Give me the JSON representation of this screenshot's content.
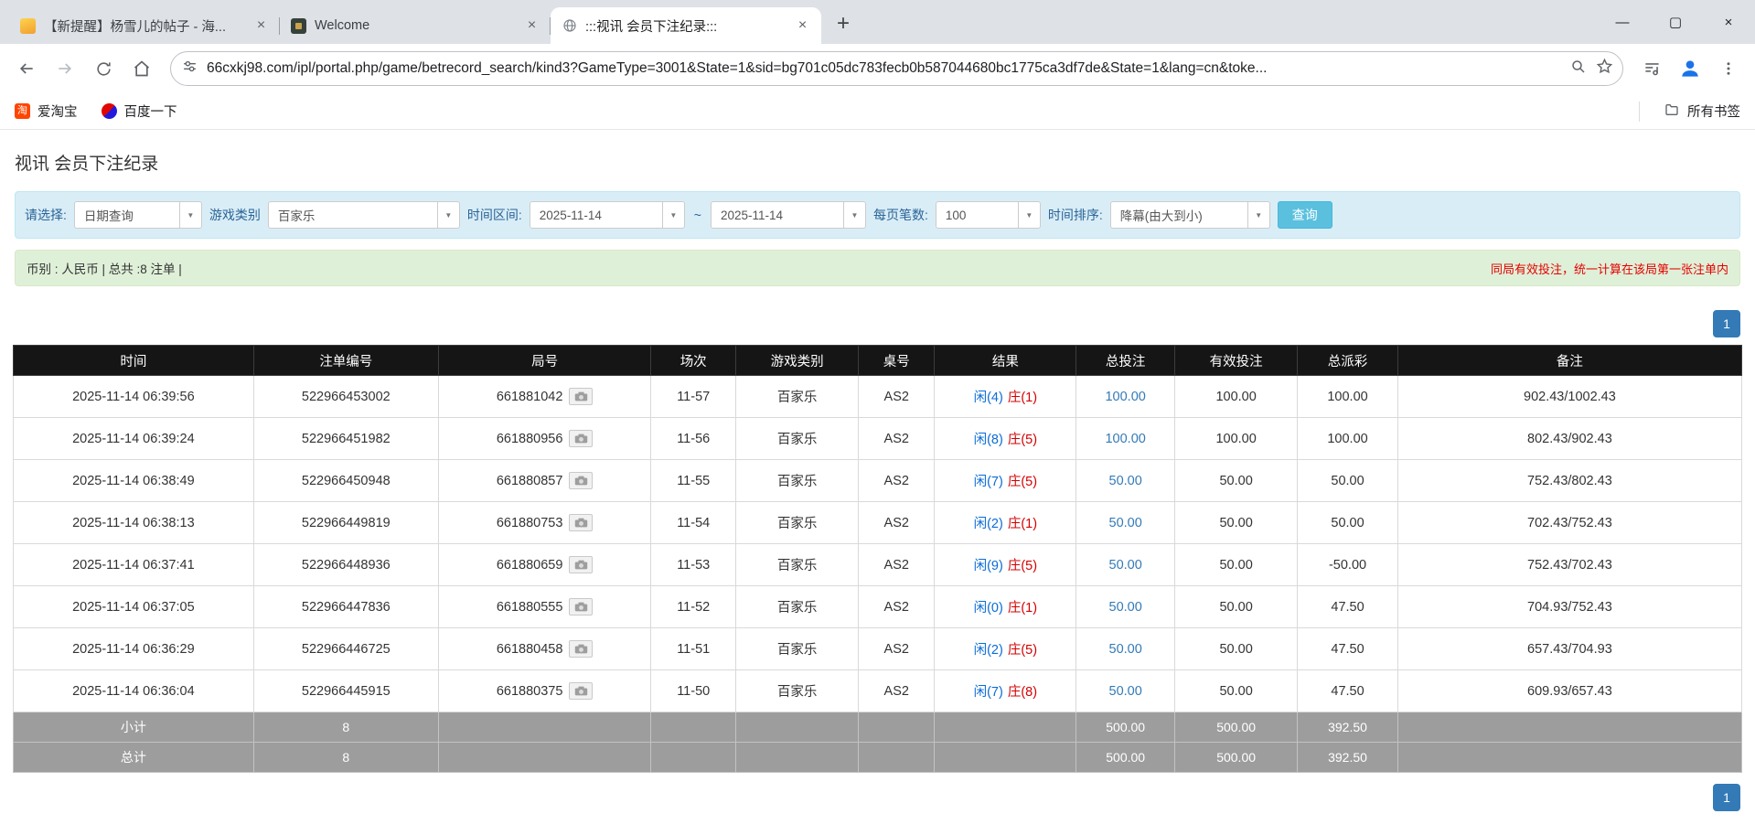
{
  "browser": {
    "tabs": [
      {
        "title": "【新提醒】杨雪儿的帖子 - 海...",
        "active": false
      },
      {
        "title": "Welcome",
        "active": false
      },
      {
        "title": ":::视讯 会员下注纪录:::",
        "active": true
      }
    ],
    "tab_close": "×",
    "new_tab": "+",
    "window_controls": {
      "minimize": "—",
      "maximize": "▢",
      "close": "×"
    },
    "url": "66cxkj98.com/ipl/portal.php/game/betrecord_search/kind3?GameType=3001&State=1&sid=bg701c05dc783fecb0b587044680bc1775ca3df7de&State=1&lang=cn&toke...",
    "bookmarks": {
      "taobao": "爱淘宝",
      "taobao_glyph": "淘",
      "baidu": "百度一下",
      "all_bookmarks": "所有书签"
    }
  },
  "page": {
    "title": "视讯 会员下注纪录",
    "filters": {
      "caret": "▼",
      "select_label": "请选择:",
      "select_value": "日期查询",
      "game_type_label": "游戏类别",
      "game_type_value": "百家乐",
      "time_range_label": "时间区间:",
      "time_from": "2025-11-14",
      "time_separator": "~",
      "time_to": "2025-11-14",
      "per_page_label": "每页笔数:",
      "per_page_value": "100",
      "sort_label": "时间排序:",
      "sort_value": "降幕(由大到小)",
      "search_button": "查询"
    },
    "summary": {
      "left": "币别 : 人民币 | 总共 :8 注单 |",
      "right": "同局有效投注，统一计算在该局第一张注单内"
    },
    "pagination": "1",
    "table": {
      "headers": [
        "时间",
        "注单编号",
        "局号",
        "场次",
        "游戏类别",
        "桌号",
        "结果",
        "总投注",
        "有效投注",
        "总派彩",
        "备注"
      ],
      "rows": [
        {
          "time": "2025-11-14 06:39:56",
          "bet_id": "522966453002",
          "round_id": "661881042",
          "session": "11-57",
          "game": "百家乐",
          "table_no": "AS2",
          "result_player": "闲(4)",
          "result_banker": "庄(1)",
          "total_bet": "100.00",
          "valid_bet": "100.00",
          "payout": "100.00",
          "note": "902.43/1002.43"
        },
        {
          "time": "2025-11-14 06:39:24",
          "bet_id": "522966451982",
          "round_id": "661880956",
          "session": "11-56",
          "game": "百家乐",
          "table_no": "AS2",
          "result_player": "闲(8)",
          "result_banker": "庄(5)",
          "total_bet": "100.00",
          "valid_bet": "100.00",
          "payout": "100.00",
          "note": "802.43/902.43"
        },
        {
          "time": "2025-11-14 06:38:49",
          "bet_id": "522966450948",
          "round_id": "661880857",
          "session": "11-55",
          "game": "百家乐",
          "table_no": "AS2",
          "result_player": "闲(7)",
          "result_banker": "庄(5)",
          "total_bet": "50.00",
          "valid_bet": "50.00",
          "payout": "50.00",
          "note": "752.43/802.43"
        },
        {
          "time": "2025-11-14 06:38:13",
          "bet_id": "522966449819",
          "round_id": "661880753",
          "session": "11-54",
          "game": "百家乐",
          "table_no": "AS2",
          "result_player": "闲(2)",
          "result_banker": "庄(1)",
          "total_bet": "50.00",
          "valid_bet": "50.00",
          "payout": "50.00",
          "note": "702.43/752.43"
        },
        {
          "time": "2025-11-14 06:37:41",
          "bet_id": "522966448936",
          "round_id": "661880659",
          "session": "11-53",
          "game": "百家乐",
          "table_no": "AS2",
          "result_player": "闲(9)",
          "result_banker": "庄(5)",
          "total_bet": "50.00",
          "valid_bet": "50.00",
          "payout": "-50.00",
          "note": "752.43/702.43"
        },
        {
          "time": "2025-11-14 06:37:05",
          "bet_id": "522966447836",
          "round_id": "661880555",
          "session": "11-52",
          "game": "百家乐",
          "table_no": "AS2",
          "result_player": "闲(0)",
          "result_banker": "庄(1)",
          "total_bet": "50.00",
          "valid_bet": "50.00",
          "payout": "47.50",
          "note": "704.93/752.43"
        },
        {
          "time": "2025-11-14 06:36:29",
          "bet_id": "522966446725",
          "round_id": "661880458",
          "session": "11-51",
          "game": "百家乐",
          "table_no": "AS2",
          "result_player": "闲(2)",
          "result_banker": "庄(5)",
          "total_bet": "50.00",
          "valid_bet": "50.00",
          "payout": "47.50",
          "note": "657.43/704.93"
        },
        {
          "time": "2025-11-14 06:36:04",
          "bet_id": "522966445915",
          "round_id": "661880375",
          "session": "11-50",
          "game": "百家乐",
          "table_no": "AS2",
          "result_player": "闲(7)",
          "result_banker": "庄(8)",
          "total_bet": "50.00",
          "valid_bet": "50.00",
          "payout": "47.50",
          "note": "609.93/657.43"
        }
      ],
      "subtotal": {
        "label": "小计",
        "count": "8",
        "total_bet": "500.00",
        "valid_bet": "500.00",
        "payout": "392.50"
      },
      "total": {
        "label": "总计",
        "count": "8",
        "total_bet": "500.00",
        "valid_bet": "500.00",
        "payout": "392.50"
      }
    }
  }
}
